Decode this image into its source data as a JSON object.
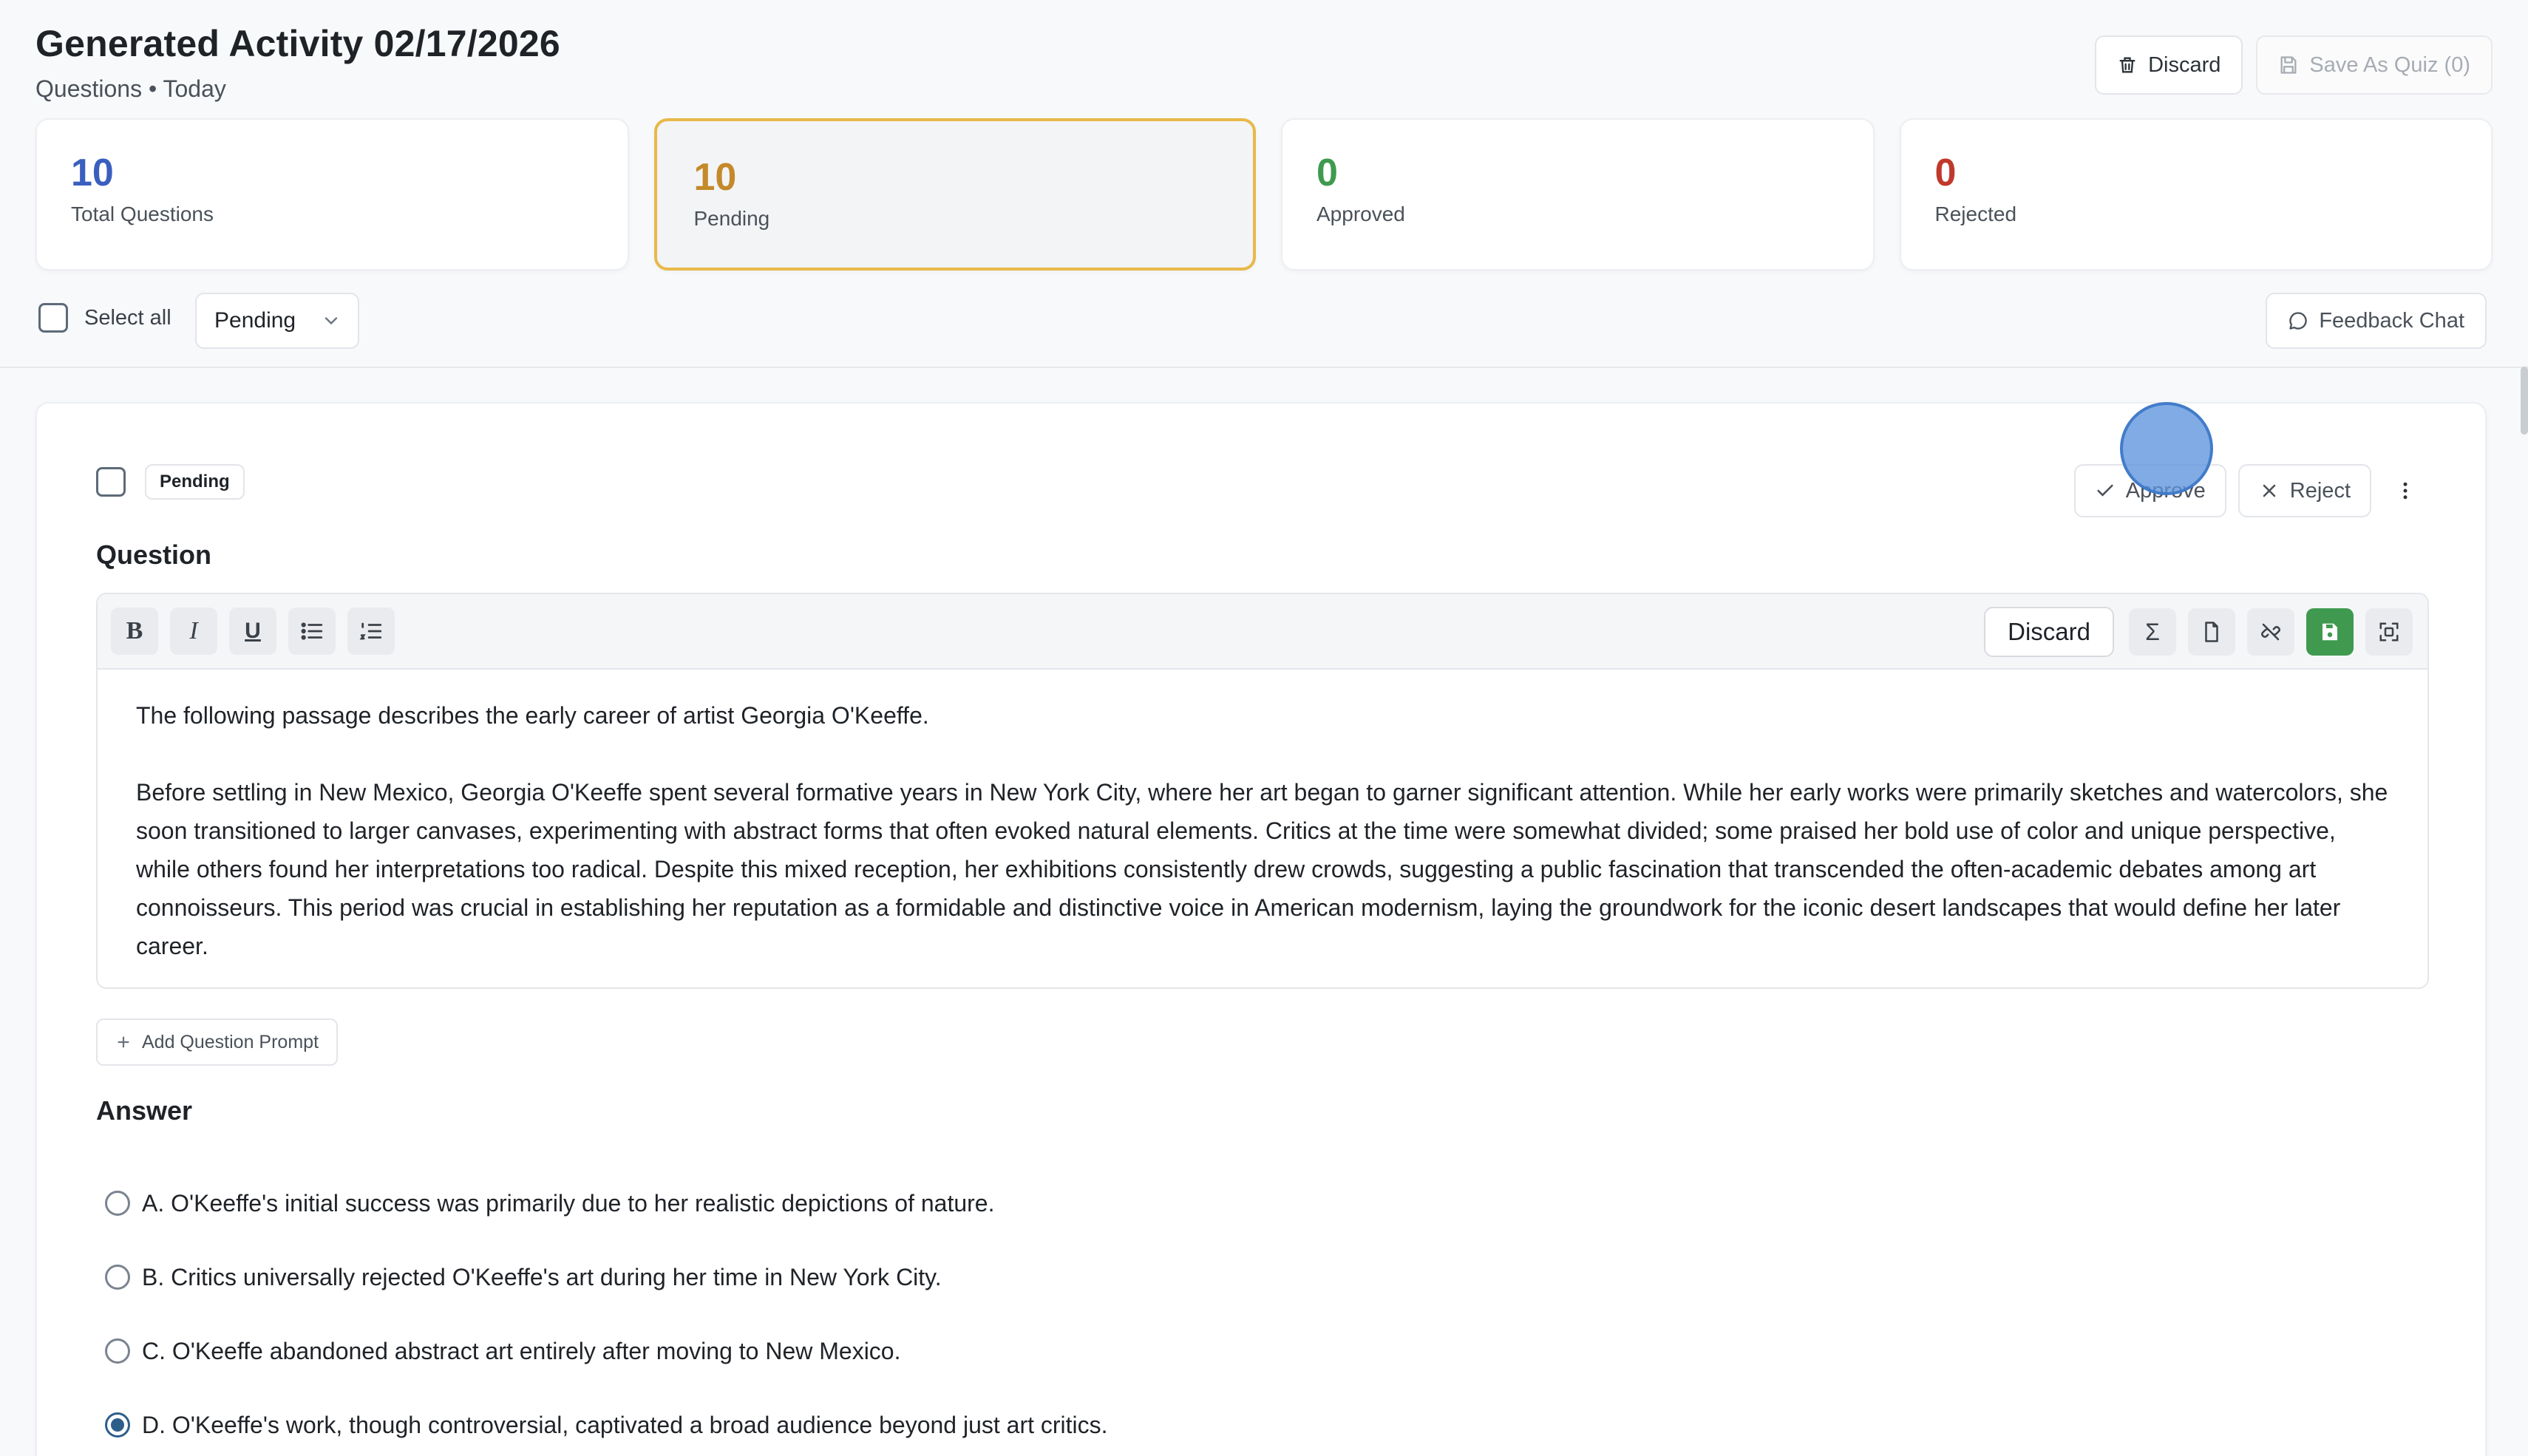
{
  "header": {
    "title": "Generated Activity 02/17/2026",
    "subtitle": "Questions • Today",
    "discard_label": "Discard",
    "save_label": "Save As Quiz (0)"
  },
  "stats": [
    {
      "value": "10",
      "label": "Total Questions",
      "color": "#3a5fbf"
    },
    {
      "value": "10",
      "label": "Pending",
      "color": "#c4892a"
    },
    {
      "value": "0",
      "label": "Approved",
      "color": "#3f9a4f"
    },
    {
      "value": "0",
      "label": "Rejected",
      "color": "#c0392b"
    }
  ],
  "filters": {
    "select_all_label": "Select all",
    "status_value": "Pending",
    "feedback_label": "Feedback Chat"
  },
  "question_card": {
    "status_badge": "Pending",
    "approve_label": "Approve",
    "reject_label": "Reject",
    "question_heading": "Question",
    "editor": {
      "discard_label": "Discard",
      "paragraphs": [
        "The following passage describes the early career of artist Georgia O'Keeffe.",
        "Before settling in New Mexico, Georgia O'Keeffe spent several formative years in New York City, where her art began to garner significant attention. While her early works were primarily sketches and watercolors, she soon transitioned to larger canvases, experimenting with abstract forms that often evoked natural elements. Critics at the time were somewhat divided; some praised her bold use of color and unique perspective, while others found her interpretations too radical. Despite this mixed reception, her exhibitions consistently drew crowds, suggesting a public fascination that transcended the often-academic debates among art connoisseurs. This period was crucial in establishing her reputation as a formidable and distinctive voice in American modernism, laying the groundwork for the iconic desert landscapes that would define her later career."
      ]
    },
    "add_prompt_label": "Add Question Prompt",
    "answer_heading": "Answer",
    "answers": [
      {
        "text": "A. O'Keeffe's initial success was primarily due to her realistic depictions of nature.",
        "selected": false
      },
      {
        "text": "B. Critics universally rejected O'Keeffe's art during her time in New York City.",
        "selected": false
      },
      {
        "text": "C. O'Keeffe abandoned abstract art entirely after moving to New Mexico.",
        "selected": false
      },
      {
        "text": "D. O'Keeffe's work, though controversial, captivated a broad audience beyond just art critics.",
        "selected": true
      }
    ]
  },
  "icons": {
    "trash": "trash-icon",
    "save": "floppy-disk-icon",
    "chat": "chat-bubble-icon",
    "check": "check-icon",
    "close": "x-icon",
    "more": "vertical-dots-icon",
    "plus": "plus-icon"
  },
  "colors": {
    "accent_pending_border": "#e8b849",
    "save_green": "#3f9a4f",
    "radio_selected": "#2d5e8a"
  }
}
